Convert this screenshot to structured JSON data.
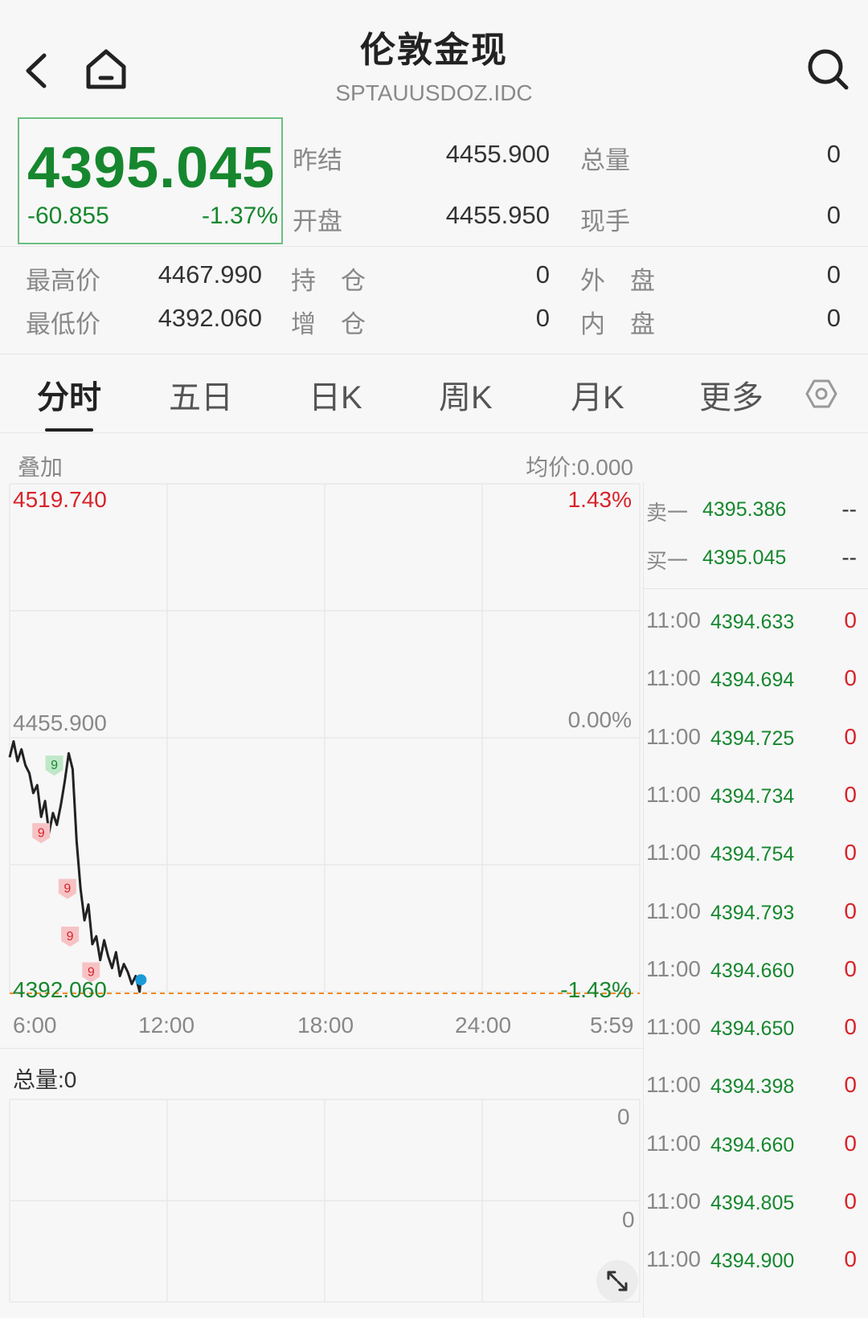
{
  "header": {
    "title": "伦敦金现",
    "code": "SPTAUUSDOZ.IDC"
  },
  "quote": {
    "price": "4395.045",
    "change": "-60.855",
    "change_pct": "-1.37%",
    "prev_settle_label": "昨结",
    "prev_settle": "4455.900",
    "open_label": "开盘",
    "open": "4455.950",
    "volume_label": "总量",
    "volume": "0",
    "current_label": "现手",
    "current": "0",
    "high_label": "最高价",
    "high": "4467.990",
    "low_label": "最低价",
    "low": "4392.060",
    "oi_label": "持　仓",
    "oi": "0",
    "oi_chg_label": "增　仓",
    "oi_chg": "0",
    "outer_label": "外　盘",
    "outer": "0",
    "inner_label": "内　盘",
    "inner": "0"
  },
  "tabs": [
    "分时",
    "五日",
    "日K",
    "周K",
    "月K",
    "更多"
  ],
  "chart": {
    "overlay_label": "叠加",
    "avg_label": "均价:0.000",
    "max_price": "4519.740",
    "max_pct": "1.43%",
    "ref_price": "4455.900",
    "ref_pct": "0.00%",
    "min_price": "4392.060",
    "min_pct": "-1.43%",
    "time_labels": [
      "6:00",
      "12:00",
      "18:00",
      "24:00",
      "5:59"
    ],
    "volume_label": "总量:0",
    "vol_top": "0",
    "vol_mid": "0",
    "marker_label": "9",
    "colors": {
      "line": "#222222",
      "down": "#16872e",
      "up": "#d8232a",
      "dash": "#f08a24"
    }
  },
  "chart_data": {
    "type": "line",
    "ylim": [
      4392.06,
      4519.74
    ],
    "reference": 4455.9,
    "x": [
      0,
      0.15,
      0.3,
      0.45,
      0.6,
      0.75,
      0.9,
      1.05,
      1.2,
      1.35,
      1.5,
      1.65,
      1.8,
      1.95,
      2.1,
      2.25,
      2.4,
      2.55,
      2.7,
      2.85,
      3.0,
      3.15,
      3.3,
      3.45,
      3.6,
      3.75,
      3.9,
      4.05,
      4.2,
      4.35,
      4.5,
      4.65,
      4.8,
      4.95,
      5.0
    ],
    "y": [
      4451,
      4455,
      4450,
      4453,
      4449,
      4447,
      4442,
      4444,
      4436,
      4440,
      4432,
      4437,
      4434,
      4439,
      4445,
      4452,
      4448,
      4430,
      4418,
      4410,
      4414,
      4404,
      4406,
      4400,
      4405,
      4401,
      4398,
      4402,
      4396,
      4399,
      4397,
      4394,
      4396,
      4392.06,
      4395.045
    ],
    "markers": [
      {
        "x": 1.7,
        "y": 4449,
        "kind": "down"
      },
      {
        "x": 1.2,
        "y": 4432,
        "kind": "up"
      },
      {
        "x": 2.2,
        "y": 4418,
        "kind": "up"
      },
      {
        "x": 2.3,
        "y": 4406,
        "kind": "up"
      },
      {
        "x": 3.1,
        "y": 4397,
        "kind": "up"
      }
    ],
    "xlabels": [
      "6:00",
      "12:00",
      "18:00",
      "24:00",
      "5:59"
    ]
  },
  "orderbook": [
    {
      "label": "卖一",
      "price": "4395.386",
      "vol": "--"
    },
    {
      "label": "买一",
      "price": "4395.045",
      "vol": "--"
    }
  ],
  "ticks": [
    {
      "time": "11:00",
      "price": "4394.633",
      "vol": "0"
    },
    {
      "time": "11:00",
      "price": "4394.694",
      "vol": "0"
    },
    {
      "time": "11:00",
      "price": "4394.725",
      "vol": "0"
    },
    {
      "time": "11:00",
      "price": "4394.734",
      "vol": "0"
    },
    {
      "time": "11:00",
      "price": "4394.754",
      "vol": "0"
    },
    {
      "time": "11:00",
      "price": "4394.793",
      "vol": "0"
    },
    {
      "time": "11:00",
      "price": "4394.660",
      "vol": "0"
    },
    {
      "time": "11:00",
      "price": "4394.650",
      "vol": "0"
    },
    {
      "time": "11:00",
      "price": "4394.398",
      "vol": "0"
    },
    {
      "time": "11:00",
      "price": "4394.660",
      "vol": "0"
    },
    {
      "time": "11:00",
      "price": "4394.805",
      "vol": "0"
    },
    {
      "time": "11:00",
      "price": "4394.900",
      "vol": "0"
    }
  ]
}
